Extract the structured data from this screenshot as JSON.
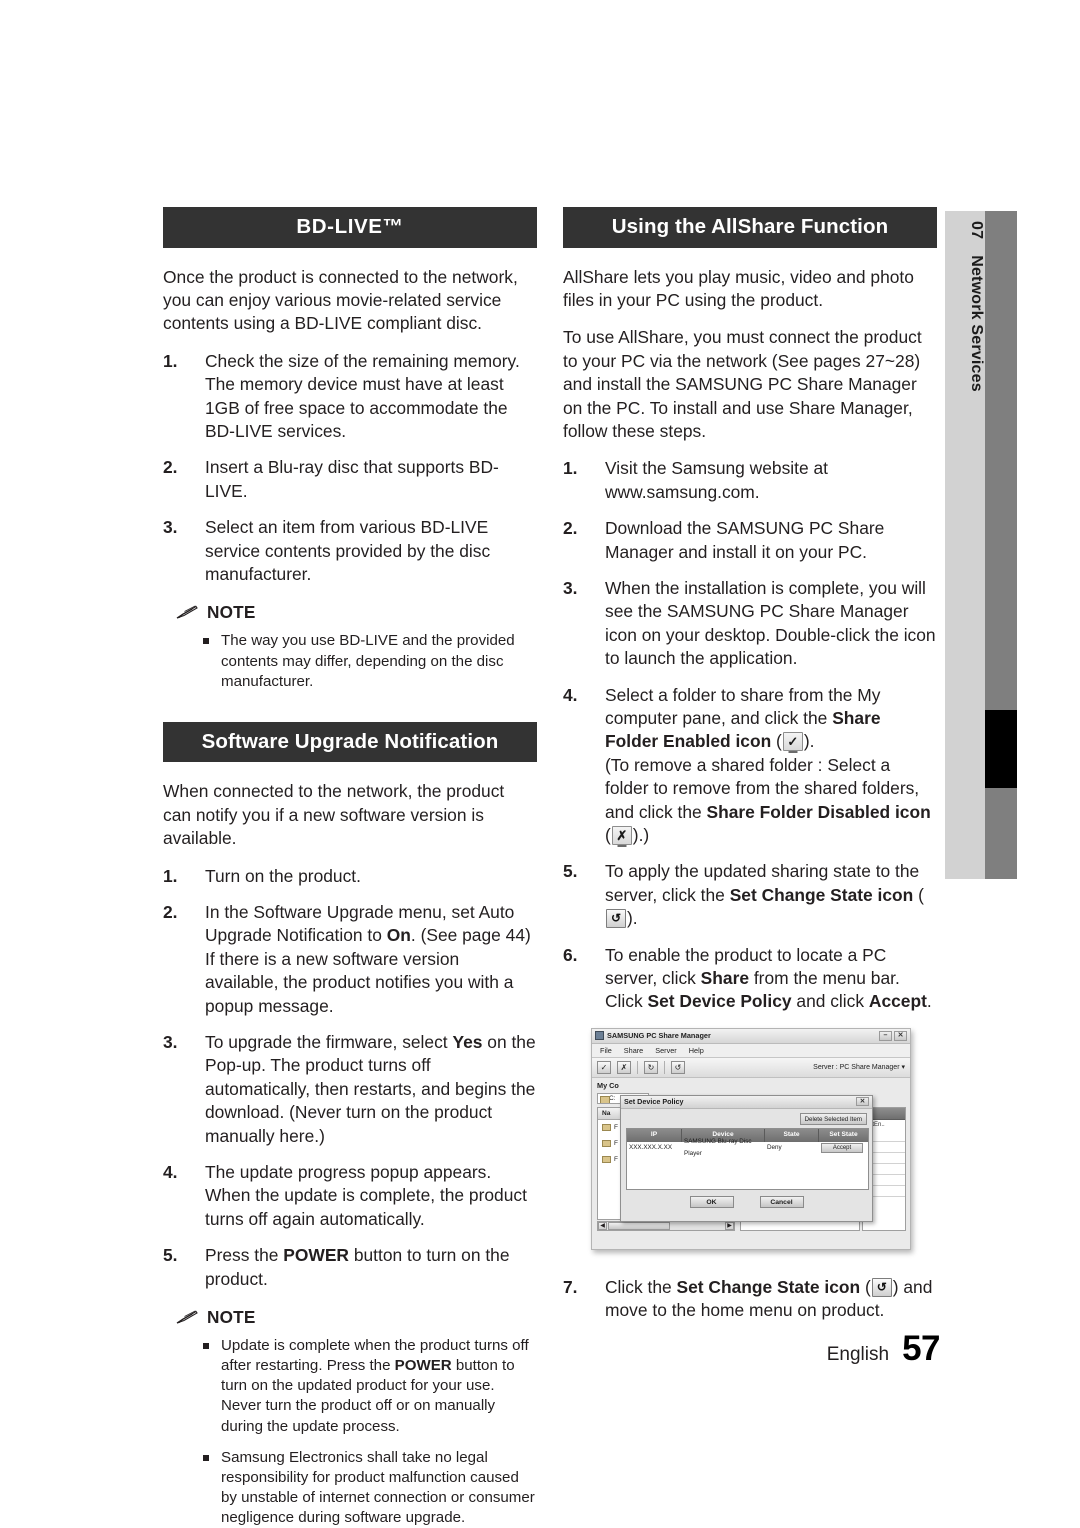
{
  "document": {
    "footer_language": "English",
    "footer_page_number": "57",
    "side_tab_number": "07",
    "side_tab_label": "Network Services"
  },
  "left_column": {
    "bdlive": {
      "heading": "BD-LIVE™",
      "intro": "Once the product is connected to the network, you can enjoy various movie-related service contents using a BD-LIVE compliant disc.",
      "steps": [
        {
          "num": "1.",
          "text": "Check the size of the remaining memory. The memory device must have at least 1GB of free space to accommodate the BD-LIVE services."
        },
        {
          "num": "2.",
          "text": "Insert a Blu-ray disc that supports BD-LIVE."
        },
        {
          "num": "3.",
          "text": "Select an item from various BD-LIVE service contents provided by the disc manufacturer."
        }
      ],
      "note_label": "NOTE",
      "note_items": [
        "The way you use BD-LIVE and the provided contents may differ, depending on the disc manufacturer."
      ]
    },
    "software_upgrade": {
      "heading": "Software Upgrade Notification",
      "intro": "When connected to the network, the product can notify you if a new software version is available.",
      "steps": [
        {
          "num": "1.",
          "text": "Turn on the product."
        },
        {
          "num": "2.",
          "pre": "In the Software Upgrade menu, set Auto Upgrade Notification to ",
          "bold": "On",
          "post": ". (See page 44) If there is a new software version available, the product notifies you with a popup message."
        },
        {
          "num": "3.",
          "pre": "To upgrade the firmware, select ",
          "bold": "Yes",
          "post": " on the Pop-up. The product turns off automatically, then restarts, and begins the download. (Never turn on the product manually here.)"
        },
        {
          "num": "4.",
          "text": "The update progress popup appears. When the update is complete, the product turns off again automatically."
        },
        {
          "num": "5.",
          "pre": "Press the ",
          "bold": "POWER",
          "post": " button to turn on the product."
        }
      ],
      "note_label": "NOTE",
      "note_items": [
        {
          "pre": "Update is complete when the product turns off after restarting. Press the ",
          "bold": "POWER",
          "post": " button to turn on the updated product for your use. Never turn the product off or on manually during the update process."
        },
        {
          "pre": "Samsung Electronics shall take no legal responsibility for product malfunction caused by unstable of internet connection or consumer negligence during software upgrade.",
          "bold": "",
          "post": ""
        }
      ]
    }
  },
  "right_column": {
    "allshare": {
      "heading": "Using the AllShare Function",
      "intro1": "AllShare lets you play music, video and photo files in your PC using the product.",
      "intro2": "To use AllShare, you must connect the product to your PC via the network (See pages 27~28) and install the SAMSUNG PC Share Manager on the PC. To install and use Share Manager, follow these steps.",
      "steps": [
        {
          "num": "1.",
          "text": "Visit the Samsung website at www.samsung.com."
        },
        {
          "num": "2.",
          "text": "Download the SAMSUNG PC Share Manager and install it on your PC."
        },
        {
          "num": "3.",
          "text": "When the installation is complete, you will see the SAMSUNG PC Share Manager icon on your desktop. Double-click the icon to launch the application."
        },
        {
          "num": "4.",
          "seg_a": "Select a folder to share from the My computer pane, and click the ",
          "bold_a": "Share Folder Enabled icon",
          "icon_a": "share-folder-enabled-icon",
          "seg_b": ").",
          "seg_c": "(To remove a shared folder : Select a folder to remove from the shared folders, and click the ",
          "bold_b": "Share Folder Disabled icon",
          "icon_b": "share-folder-disabled-icon",
          "seg_d": ").)"
        },
        {
          "num": "5.",
          "seg_a": "To apply the updated sharing state to the server, click the ",
          "bold_a": "Set Change State icon",
          "icon_a": "set-change-state-icon",
          "seg_b": ")."
        },
        {
          "num": "6.",
          "seg_a": "To enable the product to locate a PC server, click ",
          "bold_a": "Share",
          "seg_b": " from the menu bar.",
          "seg_c": "Click ",
          "bold_b": "Set Device Policy",
          "seg_d": " and click ",
          "bold_c": "Accept",
          "seg_e": "."
        },
        {
          "num": "7.",
          "seg_a": "Click the ",
          "bold_a": "Set Change State icon",
          "icon_a": "set-change-state-icon",
          "seg_b": ") and move to the home menu on product."
        }
      ]
    },
    "screenshot": {
      "window_title": "SAMSUNG PC Share Manager",
      "menu_items": [
        "File",
        "Share",
        "Server",
        "Help"
      ],
      "toolbar_icons": [
        "share-folder-enabled-icon",
        "share-folder-disabled-icon",
        "refresh-icon",
        "set-change-state-icon"
      ],
      "server_label": "Server : PC Share Manager",
      "my_computer_label": "My Co",
      "path_value": "C:",
      "tree_header": "Na",
      "tree_rows": [
        "F",
        "F",
        "F"
      ],
      "far_column_header": "setEn..",
      "dialog": {
        "title": "Set Device Policy",
        "delete_button": "Delete Selected Item",
        "columns": [
          "IP",
          "Device",
          "State",
          "Set State"
        ],
        "rows": [
          {
            "ip": "XXX.XXX.X.XX",
            "device": "SAMSUNG Blu-ray Disc Player",
            "state": "Deny",
            "set_state": "Accept"
          }
        ],
        "ok_button": "OK",
        "cancel_button": "Cancel",
        "close_button": "✕"
      },
      "minimize_button": "–",
      "close_button": "✕"
    }
  }
}
